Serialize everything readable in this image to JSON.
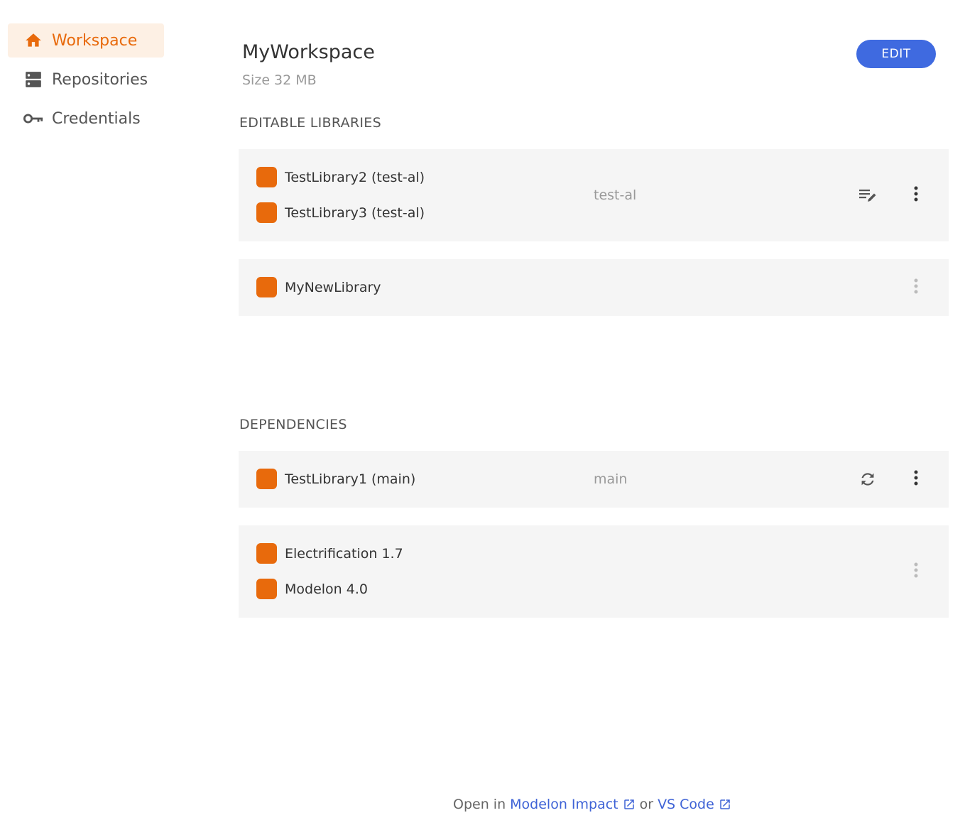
{
  "sidebar": {
    "items": [
      {
        "label": "Workspace",
        "icon": "home-icon",
        "active": true
      },
      {
        "label": "Repositories",
        "icon": "server-icon",
        "active": false
      },
      {
        "label": "Credentials",
        "icon": "key-icon",
        "active": false
      }
    ]
  },
  "header": {
    "title": "MyWorkspace",
    "size": "Size 32 MB",
    "edit_label": "EDIT"
  },
  "editable": {
    "title": "EDITABLE LIBRARIES",
    "groups": [
      {
        "libraries": [
          "TestLibrary2 (test-al)",
          "TestLibrary3 (test-al)"
        ],
        "branch": "test-al",
        "action_icon": "edit-list-icon"
      },
      {
        "libraries": [
          "MyNewLibrary"
        ],
        "branch": "",
        "action_icon": ""
      }
    ]
  },
  "dependencies": {
    "title": "DEPENDENCIES",
    "groups": [
      {
        "libraries": [
          "TestLibrary1 (main)"
        ],
        "branch": "main",
        "action_icon": "sync-icon"
      },
      {
        "libraries": [
          "Electrification 1.7",
          "Modelon 4.0"
        ],
        "branch": "",
        "action_icon": ""
      }
    ]
  },
  "footer": {
    "prefix": "Open in",
    "link1": "Modelon Impact",
    "middle": "or",
    "link2": "VS Code"
  },
  "colors": {
    "accent": "#e86a0c",
    "primary": "#3f6ae0",
    "card_bg": "#f5f5f5"
  }
}
